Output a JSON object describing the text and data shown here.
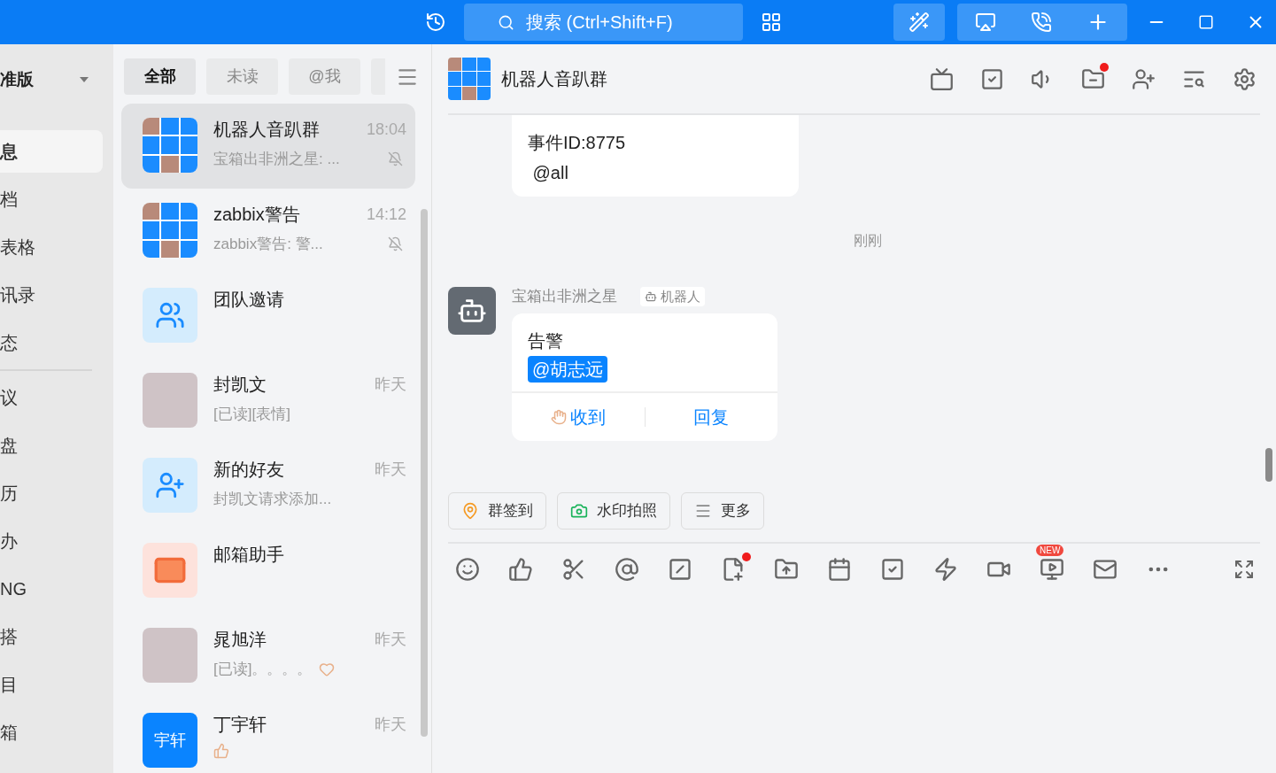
{
  "titlebar": {
    "search": {
      "placeholder": "搜索 (Ctrl+Shift+F)"
    }
  },
  "nav": {
    "header": "准版",
    "items": [
      {
        "label": "息",
        "selected": true
      },
      {
        "label": "档",
        "selected": false
      },
      {
        "label": "表格",
        "selected": false
      },
      {
        "label": "讯录",
        "selected": false
      },
      {
        "label": "态",
        "selected": false
      }
    ],
    "more_items": [
      {
        "label": "议",
        "selected": false
      },
      {
        "label": "盘",
        "selected": false
      },
      {
        "label": "历",
        "selected": false
      },
      {
        "label": "办",
        "selected": false
      },
      {
        "label": "NG",
        "selected": false
      },
      {
        "label": "搭",
        "selected": false
      },
      {
        "label": "目",
        "selected": false
      },
      {
        "label": "箱",
        "selected": false
      }
    ]
  },
  "tabs": [
    {
      "label": "全部",
      "selected": true
    },
    {
      "label": "未读",
      "selected": false
    },
    {
      "label": "@我",
      "selected": false
    }
  ],
  "conversations": [
    {
      "name": "机器人音趴群",
      "preview": "宝箱出非洲之星: ...",
      "time": "18:04",
      "muted": true,
      "selected": true,
      "kind": "grid"
    },
    {
      "name": "zabbix警告",
      "preview": "zabbix警告: 警...",
      "time": "14:12",
      "muted": true,
      "selected": false,
      "kind": "grid"
    },
    {
      "name": "团队邀请",
      "selected": false,
      "muted": false,
      "kind": "team"
    },
    {
      "name": "封凯文",
      "preview": "[已读][表情]",
      "time": "昨天",
      "muted": false,
      "selected": false,
      "kind": "photo"
    },
    {
      "name": "新的好友",
      "preview": "封凯文请求添加...",
      "time": "昨天",
      "muted": false,
      "selected": false,
      "kind": "friend"
    },
    {
      "name": "邮箱助手",
      "selected": false,
      "muted": false,
      "kind": "mail"
    },
    {
      "name": "晁旭洋",
      "preview": "[已读]。。。。",
      "preview_emoji": {
        "kind": "heart"
      },
      "time": "昨天",
      "muted": false,
      "selected": false,
      "kind": "photo"
    },
    {
      "name": "丁宇轩",
      "preview_emoji": {
        "kind": "thumb"
      },
      "time": "昨天",
      "muted": false,
      "selected": false,
      "kind": "text",
      "avatar_text": "宇轩"
    }
  ],
  "chat": {
    "title": "机器人音趴群",
    "folder_unread": true,
    "earlier_lines": [
      "事件ID:8775",
      " @all"
    ],
    "time_divider": "刚刚",
    "message": {
      "sender": "宝箱出非洲之星",
      "tag": "机器人",
      "text": "告警",
      "mention": "@胡志远",
      "actions": [
        {
          "label": "收到",
          "kind": "ok"
        },
        {
          "label": "回复",
          "kind": "plain"
        }
      ]
    },
    "quick_actions": [
      {
        "label": "群签到",
        "kind": "location"
      },
      {
        "label": "水印拍照",
        "kind": "camera"
      },
      {
        "label": "更多",
        "kind": "menu"
      }
    ],
    "composer": {
      "note_unread": true,
      "video_badge": "NEW"
    }
  }
}
